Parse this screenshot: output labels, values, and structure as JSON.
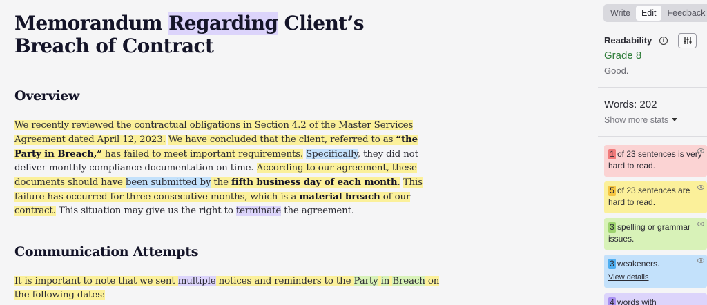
{
  "document": {
    "title_pre": "Memorandum ",
    "title_hl": "Regarding",
    "title_post": " Client’s Breach of Contract",
    "heading_overview": "Overview",
    "overview": {
      "s1": "We recently reviewed the contractual obligations in Section 4.2 of the Master Services Agreement dated April 12, 2023.",
      "sp1": " ",
      "s2a": "We have concluded that the client, referred to as ",
      "s2b": "“the Party in Breach,”",
      "s2c": " has failed to meet important requirements.",
      "sp2": " ",
      "s3a": "Specifically",
      "s3b": ", they did not deliver monthly compliance documentation on time.",
      "sp3": " ",
      "s4a": "According to our agreement, these documents should have ",
      "s4b": "been submitted by",
      "s4c": " the ",
      "s4d": "fifth business day of each month",
      "s4e": ".",
      "sp4": " ",
      "s5a": "This failure has occurred for three consecutive months, which is a ",
      "s5b": "material breach",
      "s5c": " of our contract.",
      "s6a": " This situation may give us the right to ",
      "s6b": "terminate",
      "s6c": " the agreement."
    },
    "heading_comm": "Communication Attempts",
    "comm": {
      "a": "It is important to note that we sent ",
      "b": "multiple",
      "c": " notices and reminders to the ",
      "d": "Party",
      "e": " ",
      "f": "in",
      "g": " ",
      "h": "Breach",
      "i": " on the following dates:"
    }
  },
  "sidebar": {
    "tabs": [
      "Write",
      "Edit",
      "Feedback"
    ],
    "active_tab": "Edit",
    "readability_label": "Readability",
    "grade": "Grade 8",
    "grade_note": "Good.",
    "words": "Words: 202",
    "show_more": "Show more stats",
    "cards": {
      "very_hard": {
        "count": "1",
        "text": "of 23 sentences is very hard to read."
      },
      "hard": {
        "count": "5",
        "text": "of 23 sentences are hard to read."
      },
      "spelling": {
        "count": "3",
        "text": "spelling or grammar issues."
      },
      "weakeners": {
        "count": "3",
        "text": "weakeners.",
        "link": "View details"
      },
      "words_with": {
        "count": "4",
        "text": "words with"
      }
    }
  },
  "colors": {
    "highlight_yellow": "#fbf09a",
    "highlight_blue": "#c3e1fb",
    "highlight_purple": "#dcd4fb",
    "highlight_green": "#d8f2b8",
    "grade_green": "#2f7d3a"
  }
}
